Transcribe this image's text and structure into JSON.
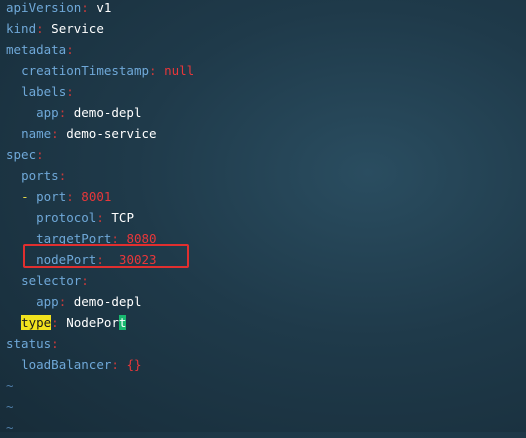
{
  "yaml": {
    "apiVersion_key": "apiVersion",
    "apiVersion_val": "v1",
    "kind_key": "kind",
    "kind_val": "Service",
    "metadata_key": "metadata",
    "creationTimestamp_key": "creationTimestamp",
    "creationTimestamp_val": "null",
    "labels_key": "labels",
    "app_key": "app",
    "app_val": "demo-depl",
    "name_key": "name",
    "name_val": "demo-service",
    "spec_key": "spec",
    "ports_key": "ports",
    "dash": "-",
    "port_key": "port",
    "port_val": "8001",
    "protocol_key": "protocol",
    "protocol_val": "TCP",
    "targetPort_key": "targetPort",
    "targetPort_val": "8080",
    "nodePort_key": "nodePort",
    "nodePort_val": "30023",
    "selector_key": "selector",
    "selector_app_key": "app",
    "selector_app_val": "demo-depl",
    "type_key": "type",
    "type_val_main": "NodePor",
    "type_val_cursor": "t",
    "status_key": "status",
    "loadBalancer_key": "loadBalancer",
    "loadBalancer_val": "{}",
    "tilde": "~"
  },
  "colors": {
    "key": "#6fa8d8",
    "number": "#e8373a",
    "highlight_box": "#e02f2f",
    "search_match": "#f1e21e",
    "cursor": "#19b86f"
  }
}
